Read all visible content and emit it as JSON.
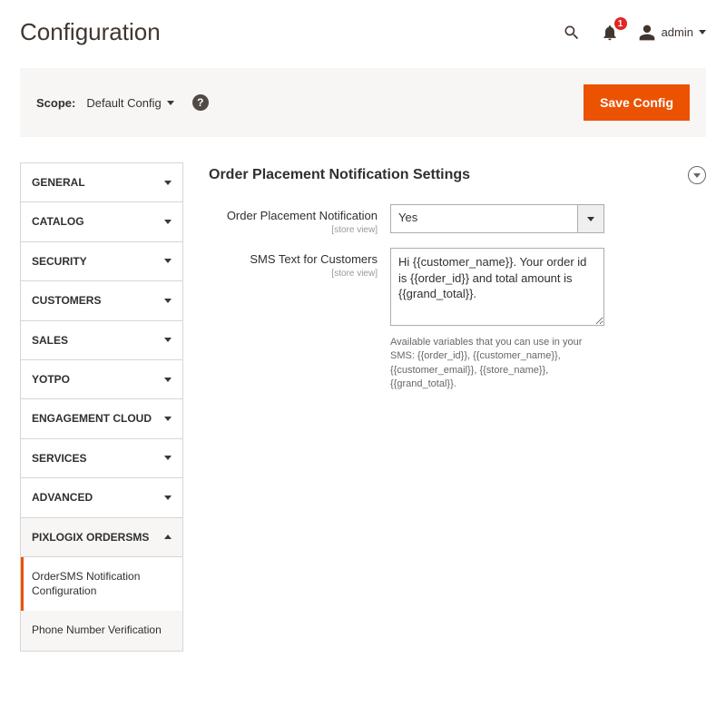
{
  "header": {
    "title": "Configuration",
    "notif_count": "1",
    "user_name": "admin"
  },
  "scope": {
    "label": "Scope:",
    "value": "Default Config",
    "help": "?",
    "save_button": "Save Config"
  },
  "sidebar": {
    "items": [
      {
        "label": "GENERAL",
        "expanded": false
      },
      {
        "label": "CATALOG",
        "expanded": false
      },
      {
        "label": "SECURITY",
        "expanded": false
      },
      {
        "label": "CUSTOMERS",
        "expanded": false
      },
      {
        "label": "SALES",
        "expanded": false
      },
      {
        "label": "YOTPO",
        "expanded": false
      },
      {
        "label": "ENGAGEMENT CLOUD",
        "expanded": false
      },
      {
        "label": "SERVICES",
        "expanded": false
      },
      {
        "label": "ADVANCED",
        "expanded": false
      },
      {
        "label": "PIXLOGIX ORDERSMS",
        "expanded": true
      }
    ],
    "subitems": [
      {
        "label": "OrderSMS Notification Configuration",
        "active": true
      },
      {
        "label": "Phone Number Verification",
        "active": false
      }
    ]
  },
  "section": {
    "title": "Order Placement Notification Settings",
    "fields": {
      "notification": {
        "label": "Order Placement Notification",
        "scope": "[store view]",
        "value": "Yes"
      },
      "sms_text": {
        "label": "SMS Text for Customers",
        "scope": "[store view]",
        "value": "Hi {{customer_name}}. Your order id is {{order_id}} and total amount is {{grand_total}}.",
        "note": "Available variables that you can use in your SMS: {{order_id}}, {{customer_name}}, {{customer_email}}, {{store_name}}, {{grand_total}}."
      }
    }
  }
}
